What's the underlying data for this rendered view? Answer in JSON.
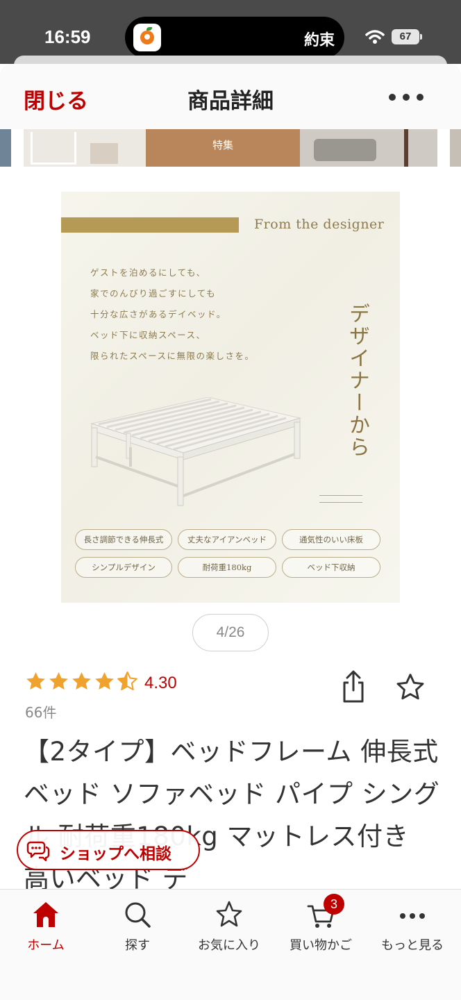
{
  "status_bar": {
    "time": "16:59",
    "island_text": "約束",
    "battery": "67",
    "icons": [
      "app-orange-icon",
      "wifi-icon",
      "battery-icon"
    ]
  },
  "nav": {
    "close_label": "閉じる",
    "title": "商品詳細",
    "more_icon": "more-dots-icon"
  },
  "banner": {
    "label": "特集"
  },
  "product_image": {
    "heading": "From the designer",
    "description_lines": [
      "ゲストを泊めるにしても、",
      "家でのんびり過ごすにしても",
      "十分な広さがあるデイベッド。",
      "ベッド下に収納スペース、",
      "限られたスペースに無限の楽しさを。"
    ],
    "vertical_title": "デザイナーから",
    "features": [
      "長さ調節できる伸長式",
      "丈夫なアイアンベッド",
      "通気性のいい床板",
      "シンプルデザイン",
      "耐荷重180kg",
      "ベッド下収納"
    ]
  },
  "gallery": {
    "counter": "4/26"
  },
  "rating": {
    "value": "4.30",
    "stars": 4.3,
    "review_count": "66件",
    "star_color": "#f0a22e"
  },
  "product": {
    "title": "【2タイプ】ベッドフレーム 伸長式ベッド ソファベッド パイプ シングル 耐荷重180kg マットレス付き 高いベッド デ"
  },
  "chat": {
    "label": "ショップへ相談",
    "icon": "chat-bubble-icon"
  },
  "tabs": [
    {
      "label": "ホーム",
      "icon": "home-icon",
      "active": true
    },
    {
      "label": "探す",
      "icon": "search-icon",
      "active": false
    },
    {
      "label": "お気に入り",
      "icon": "star-icon",
      "active": false
    },
    {
      "label": "買い物かご",
      "icon": "cart-icon",
      "active": false,
      "badge": "3"
    },
    {
      "label": "もっと見る",
      "icon": "more-dots-icon",
      "active": false
    }
  ],
  "colors": {
    "brand_red": "#bf0000",
    "gold": "#b59a55"
  }
}
